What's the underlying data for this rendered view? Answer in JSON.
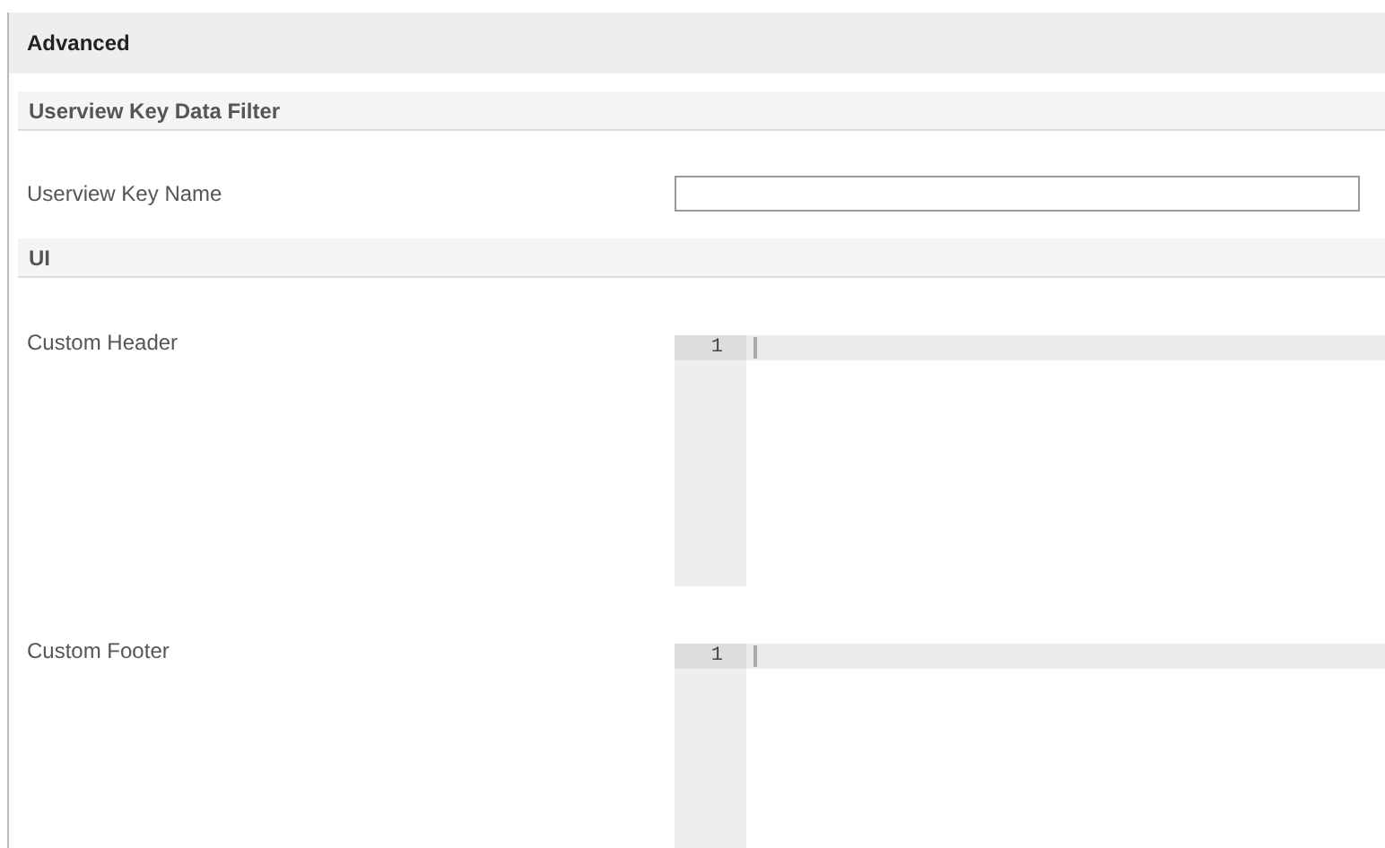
{
  "panel": {
    "title": "Advanced"
  },
  "sections": [
    {
      "title": "Userview Key Data Filter",
      "fields": [
        {
          "kind": "text",
          "label": "Userview Key Name"
        }
      ]
    },
    {
      "title": "UI",
      "fields": [
        {
          "kind": "code",
          "label": "Custom Header",
          "line_number": "1"
        },
        {
          "kind": "code",
          "label": "Custom Footer",
          "line_number": "1"
        }
      ]
    }
  ]
}
